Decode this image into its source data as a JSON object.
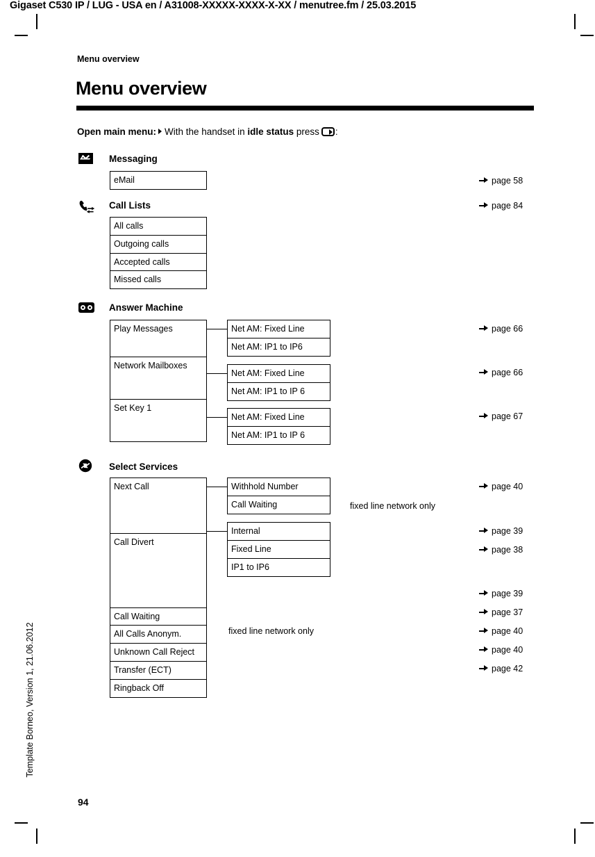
{
  "document": {
    "running_head": "Gigaset C530 IP / LUG - USA en / A31008-XXXXX-XXXX-X-XX / menutree.fm / 25.03.2015",
    "chapter_label": "Menu overview",
    "page_title": "Menu overview",
    "template_note": "Template Borneo, Version 1, 21.06.2012",
    "folio": "94"
  },
  "intro": {
    "bold_lead": "Open main menu:",
    "text_before_bold": "With the handset in",
    "bold_mid": "idle status",
    "text_after_bold": "press",
    "colon": ":",
    "key_icon": "display-key-icon",
    "triangle_icon": "triangle-right-icon"
  },
  "groups": [
    {
      "icon": "envelope-icon",
      "title": "Messaging",
      "pageref": null,
      "col1": [
        {
          "label": "eMail",
          "pageref": "page 58"
        }
      ],
      "col2": []
    },
    {
      "icon": "call-list-icon",
      "title": "Call Lists",
      "pageref": "page 84",
      "col1": [
        {
          "label": "All calls"
        },
        {
          "label": "Outgoing calls"
        },
        {
          "label": "Accepted calls"
        },
        {
          "label": "Missed calls"
        }
      ],
      "col2": []
    },
    {
      "icon": "answer-machine-icon",
      "title": "Answer Machine",
      "pageref": null,
      "col1": [
        {
          "label": "Play Messages"
        },
        {
          "label": "Network Mailboxes"
        },
        {
          "label": "Set Key 1"
        }
      ],
      "col2": [
        {
          "label": "Net AM: Fixed Line"
        },
        {
          "label": "Net AM: IP1 to IP6"
        },
        {
          "label": "Net AM: Fixed Line"
        },
        {
          "label": "Net AM: IP1 to IP 6"
        },
        {
          "label": "Net AM: Fixed Line"
        },
        {
          "label": "Net AM: IP1 to IP 6"
        }
      ],
      "pagerefs": [
        "page 66",
        "page 66",
        "page 67"
      ]
    },
    {
      "icon": "select-services-icon",
      "title": "Select Services",
      "pageref": null,
      "col1": [
        {
          "label": "Next Call"
        },
        {
          "label": "Call Divert"
        },
        {
          "label": "Call Waiting",
          "pageref": "page 39"
        },
        {
          "label": "All Calls Anonym.",
          "pageref": "page 37"
        },
        {
          "label": "Unknown Call Reject",
          "pageref": "page 40",
          "note": "fixed line network only"
        },
        {
          "label": "Transfer (ECT)",
          "pageref": "page 40"
        },
        {
          "label": "Ringback Off",
          "pageref": "page 42"
        }
      ],
      "col2": [
        {
          "label": "Withhold Number",
          "pageref": "page 40"
        },
        {
          "label": "Call Waiting",
          "note": "fixed line network only"
        },
        {
          "label": "Internal",
          "pageref": "page 39"
        },
        {
          "label": "Fixed Line",
          "pageref": "page 38"
        },
        {
          "label": "IP1 to IP6"
        }
      ]
    }
  ],
  "colors": {
    "ink": "#000000",
    "paper": "#ffffff"
  }
}
